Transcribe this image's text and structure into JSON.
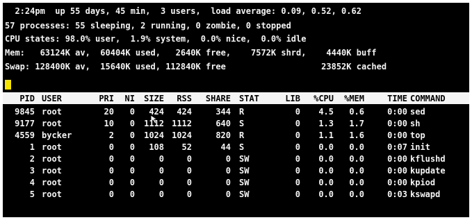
{
  "summary": {
    "uptime": "  2:24pm  up 55 days, 45 min,  3 users,  load average: 0.09, 0.52, 0.62",
    "processes": "57 processes: 55 sleeping, 2 running, 0 zombie, 0 stopped",
    "cpu": "CPU states: 98.0% user,  1.9% system,  0.0% nice,  0.0% idle",
    "mem": "Mem:   63124K av,  60404K used,   2640K free,    7572K shrd,    4440K buff",
    "swap": "Swap: 128400K av,  15640K used, 112840K free                   23852K cached"
  },
  "columns": [
    "PID",
    "USER",
    "PRI",
    "NI",
    "SIZE",
    "RSS",
    "SHARE",
    "STAT",
    "LIB",
    "%CPU",
    "%MEM",
    "TIME",
    "COMMAND"
  ],
  "rows": [
    [
      "9845",
      "root",
      "20",
      "0",
      "424",
      "424",
      "344",
      "R",
      "0",
      "4.5",
      "0.6",
      "0:00",
      "sed"
    ],
    [
      "9177",
      "root",
      "10",
      "0",
      "1112",
      "1112",
      "640",
      "S",
      "0",
      "1.3",
      "1.7",
      "0:00",
      "sh"
    ],
    [
      "4559",
      "bycker",
      "2",
      "0",
      "1024",
      "1024",
      "820",
      "R",
      "0",
      "1.1",
      "1.6",
      "0:00",
      "top"
    ],
    [
      "1",
      "root",
      "0",
      "0",
      "108",
      "52",
      "44",
      "S",
      "0",
      "0.0",
      "0.0",
      "0:07",
      "init"
    ],
    [
      "2",
      "root",
      "0",
      "0",
      "0",
      "0",
      "0",
      "SW",
      "0",
      "0.0",
      "0.0",
      "0:00",
      "kflushd"
    ],
    [
      "3",
      "root",
      "0",
      "0",
      "0",
      "0",
      "0",
      "SW",
      "0",
      "0.0",
      "0.0",
      "0:00",
      "kupdate"
    ],
    [
      "4",
      "root",
      "0",
      "0",
      "0",
      "0",
      "0",
      "SW",
      "0",
      "0.0",
      "0.0",
      "0:00",
      "kpiod"
    ],
    [
      "5",
      "root",
      "0",
      "0",
      "0",
      "0",
      "0",
      "SW",
      "0",
      "0.0",
      "0.0",
      "0:03",
      "kswapd"
    ]
  ],
  "icons": {
    "cursor": "text-cursor-block",
    "pointer": "mouse-pointer-icon"
  },
  "colors": {
    "background": "#000000",
    "text": "#f4f4f4",
    "header_bg": "#f4f4f4",
    "header_text": "#000000",
    "cursor": "#f5e400"
  }
}
